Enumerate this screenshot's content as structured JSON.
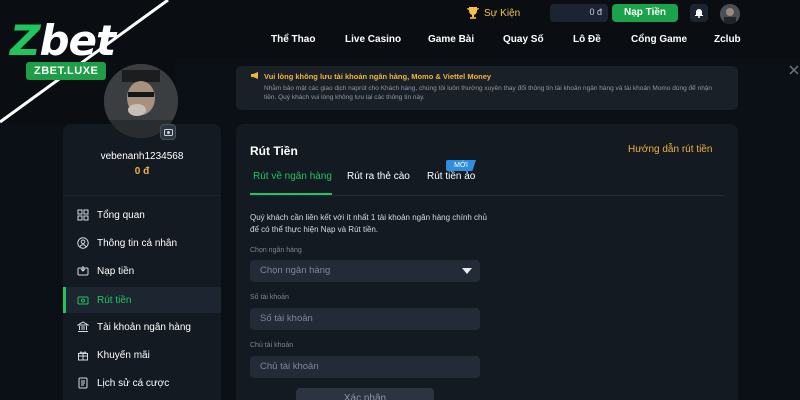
{
  "brand": {
    "logo_text_z": "Z",
    "logo_text_rest": "bet",
    "domain": "ZBET.LUXE"
  },
  "header": {
    "event_label": "Sự Kiện",
    "balance": "0 đ",
    "deposit_label": "Nạp Tiền",
    "nav": [
      "Thể Thao",
      "Live Casino",
      "Game Bài",
      "Quay Số",
      "Lô Đề",
      "Cổng Game",
      "Zclub"
    ]
  },
  "notice": {
    "title": "Vui lòng không lưu tài khoản ngân hàng, Momo & Viettel Money",
    "body": "Nhằm bảo mật các giao dịch naprút cho Khách hàng, chúng tôi luôn thường xuyên thay đổi thông tin tài khoản ngân hàng và tài khoản Momo dùng để nhận tiền. Quý khách vui lòng không lưu lại các thông tin này."
  },
  "profile": {
    "username": "vebenanh1234568",
    "balance": "0 đ"
  },
  "sidebar": {
    "items": [
      {
        "label": "Tổng quan",
        "icon": "overview-icon",
        "active": false
      },
      {
        "label": "Thông tin cá nhân",
        "icon": "user-icon",
        "active": false
      },
      {
        "label": "Nạp tiền",
        "icon": "deposit-icon",
        "active": false
      },
      {
        "label": "Rút tiền",
        "icon": "withdraw-icon",
        "active": true
      },
      {
        "label": "Tài khoản ngân hàng",
        "icon": "bank-icon",
        "active": false
      },
      {
        "label": "Khuyến mãi",
        "icon": "gift-icon",
        "active": false
      },
      {
        "label": "Lịch sử cá cược",
        "icon": "history-icon",
        "active": false
      }
    ]
  },
  "withdraw": {
    "title": "Rút Tiền",
    "guide_link": "Hướng dẫn rút tiền",
    "tabs": [
      {
        "label": "Rút về ngân hàng",
        "active": true
      },
      {
        "label": "Rút ra thẻ cào",
        "active": false
      },
      {
        "label": "Rút tiền ảo",
        "active": false,
        "badge": "MỚI"
      }
    ],
    "intro": "Quý khách cần liên kết với ít nhất 1 tài khoản ngân hàng chính chủ để có thể thực hiện Nạp và Rút tiền.",
    "bank": {
      "label": "Chọn ngân hàng",
      "placeholder": "Chọn ngân hàng"
    },
    "account_number": {
      "label": "Số tài khoản",
      "placeholder": "Số tài khoản"
    },
    "account_holder": {
      "label": "Chủ tài khoản",
      "placeholder": "Chủ tài khoản"
    },
    "submit_label": "Xác nhận"
  },
  "colors": {
    "accent": "#21c55d",
    "gold": "#f0b43c",
    "bg": "#0b1016",
    "panel": "#141a22"
  }
}
